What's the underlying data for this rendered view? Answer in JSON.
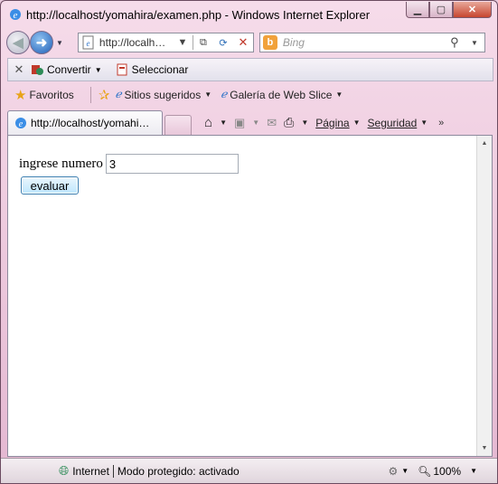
{
  "window": {
    "title": "http://localhost/yomahira/examen.php - Windows Internet Explorer"
  },
  "address_bar": {
    "url": "http://localh…"
  },
  "search_bar": {
    "placeholder": "Bing"
  },
  "command_bar": {
    "convert_label": "Convertir",
    "select_label": "Seleccionar"
  },
  "favorites_bar": {
    "favorites_label": "Favoritos",
    "items": [
      "Sitios sugeridos",
      "Galería de Web Slice"
    ]
  },
  "tab": {
    "label": "http://localhost/yomahi…"
  },
  "tools": {
    "page_label": "Página",
    "security_label": "Seguridad"
  },
  "page": {
    "label": "ingrese numero",
    "input_value": "3",
    "button_label": "evaluar"
  },
  "status_bar": {
    "zone": "Internet",
    "protected_mode": "Modo protegido: activado",
    "zoom": "100%"
  },
  "colors": {
    "frame": "#e4b7d1",
    "accent": "#1f5fb8",
    "button": "#bee6fd"
  }
}
